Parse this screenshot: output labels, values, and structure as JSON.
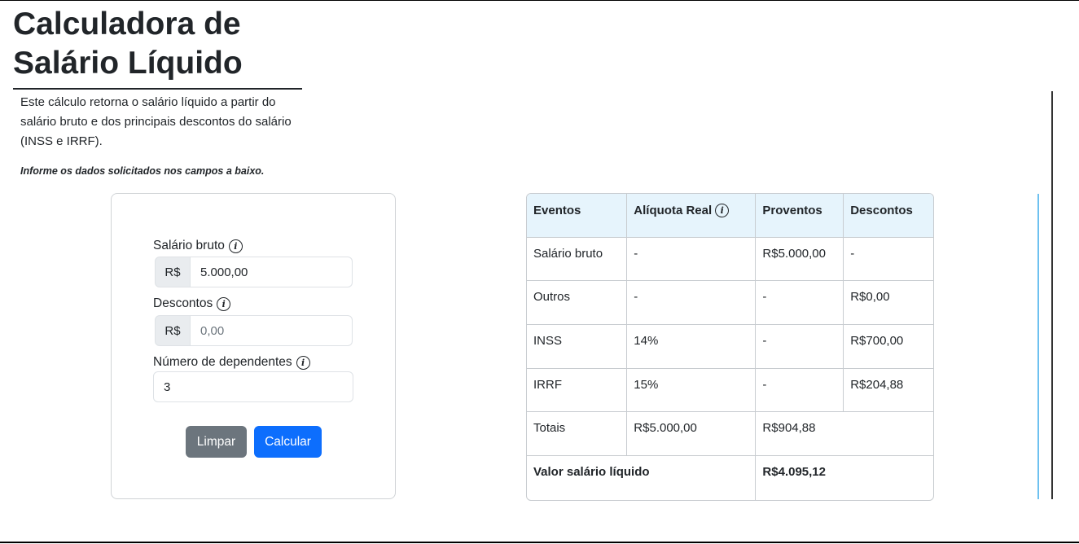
{
  "page": {
    "title": "Calculadora de Salário Líquido",
    "description": "Este cálculo retorna o salário líquido a partir do salário bruto e dos principais descontos do salário (INSS e IRRF).",
    "hint": "Informe os dados solicitados nos campos a baixo."
  },
  "form": {
    "salario_label": "Salário bruto",
    "salario_prefix": "R$",
    "salario_value": "5.000,00",
    "descontos_label": "Descontos",
    "descontos_prefix": "R$",
    "descontos_placeholder": "0,00",
    "dependentes_label": "Número de dependentes",
    "dependentes_value": "3",
    "clear_label": "Limpar",
    "calc_label": "Calcular",
    "info_glyph": "i"
  },
  "table": {
    "headers": [
      "Eventos",
      "Alíquota Real",
      "Proventos",
      "Descontos"
    ],
    "rows": [
      [
        "Salário bruto",
        "-",
        "R$5.000,00",
        "-"
      ],
      [
        "Outros",
        "-",
        "-",
        "R$0,00"
      ],
      [
        "INSS",
        "14%",
        "-",
        "R$700,00"
      ],
      [
        "IRRF",
        "15%",
        "-",
        "R$204,88"
      ]
    ],
    "totals": {
      "label": "Totais",
      "proventos": "R$5.000,00",
      "descontos": "R$904,88"
    },
    "net": {
      "label": "Valor salário líquido",
      "value": "R$4.095,12"
    }
  },
  "colors": {
    "primary": "#0d6efd",
    "secondary": "#6c757d",
    "header_bg": "#e6f4fc"
  },
  "icons": {
    "info": "info-icon"
  }
}
